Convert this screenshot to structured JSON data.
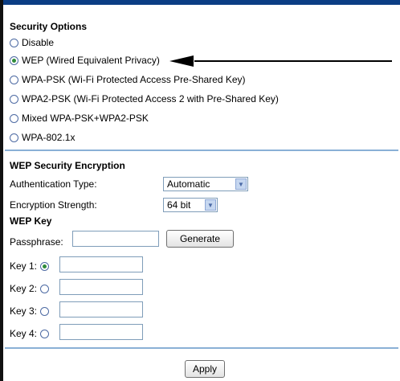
{
  "security_options": {
    "title": "Security Options",
    "options": [
      {
        "label": "Disable",
        "checked": false
      },
      {
        "label": "WEP (Wired Equivalent Privacy)",
        "checked": true
      },
      {
        "label": "WPA-PSK (Wi-Fi Protected Access Pre-Shared Key)",
        "checked": false
      },
      {
        "label": "WPA2-PSK (Wi-Fi Protected Access 2 with Pre-Shared Key)",
        "checked": false
      },
      {
        "label": "Mixed WPA-PSK+WPA2-PSK",
        "checked": false
      },
      {
        "label": "WPA-802.1x",
        "checked": false
      }
    ]
  },
  "wep": {
    "title": "WEP Security Encryption",
    "auth_label": "Authentication Type:",
    "auth_value": "Automatic",
    "strength_label": "Encryption Strength:",
    "strength_value": "64 bit",
    "key_title": "WEP Key",
    "passphrase_label": "Passphrase:",
    "generate_label": "Generate",
    "keys": [
      {
        "label": "Key 1:",
        "checked": true,
        "value": ""
      },
      {
        "label": "Key 2:",
        "checked": false,
        "value": ""
      },
      {
        "label": "Key 3:",
        "checked": false,
        "value": ""
      },
      {
        "label": "Key 4:",
        "checked": false,
        "value": ""
      }
    ]
  },
  "apply_label": "Apply",
  "colors": {
    "top_bar": "#0b3d84",
    "divider": "#8ab0d6",
    "radio_dot": "#2f8c3a"
  }
}
